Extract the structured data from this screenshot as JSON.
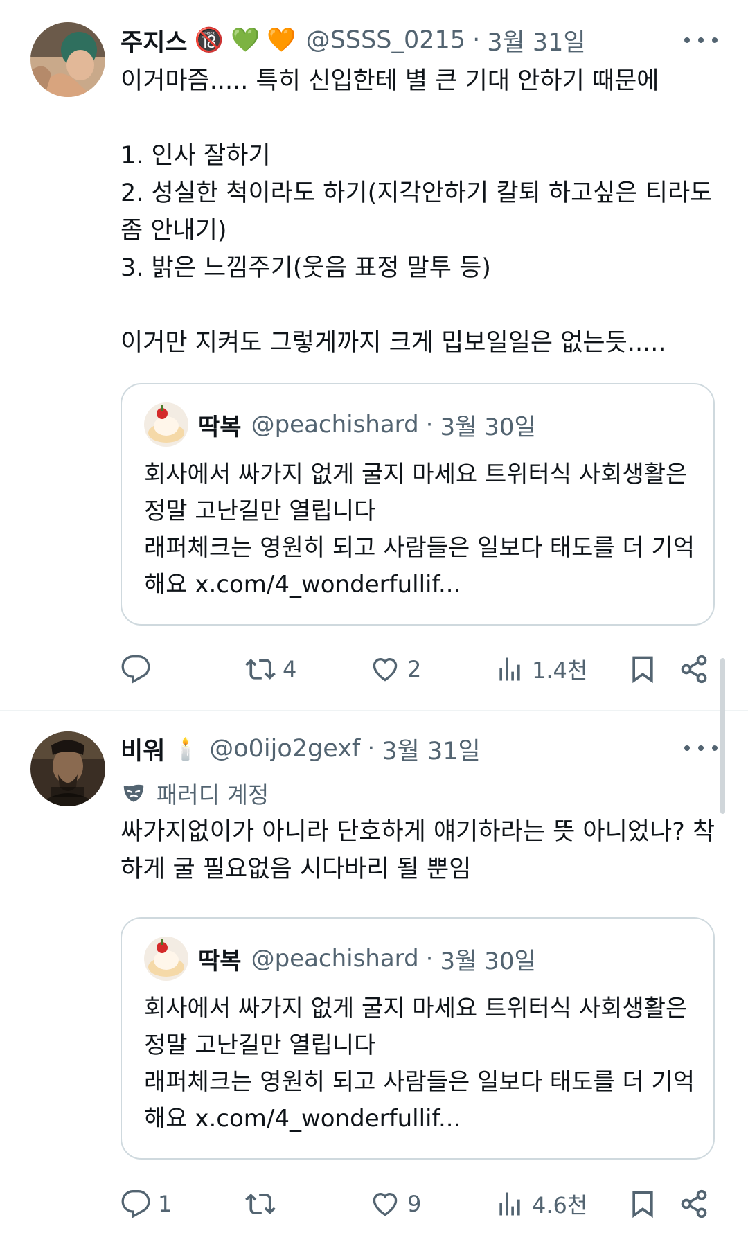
{
  "tweets": [
    {
      "name": "주지스",
      "emojis": [
        "🔞",
        "💚",
        "🧡"
      ],
      "handle": "@SSSS_0215",
      "date": "3월 31일",
      "text": "이거마즘..... 특히 신입한테 별 큰 기대 안하기 때문에\n\n1. 인사 잘하기\n2. 성실한 척이라도 하기(지각안하기 칼퇴 하고싶은 티라도 좀 안내기)\n3. 밝은 느낌주기(웃음 표정 말투 등)\n\n이거만 지켜도 그렇게까지 크게 밉보일일은 없는듯.....",
      "quote": {
        "name": "딱복",
        "handle": "@peachishard",
        "date": "3월 30일",
        "text": "회사에서 싸가지 없게 굴지 마세요 트위터식 사회생활은 정말 고난길만 열립니다\n래퍼체크는 영원히 되고 사람들은 일보다 태도를 더 기억해요 x.com/4_wonderfullif..."
      },
      "replies": "",
      "retweets": "4",
      "likes": "2",
      "views": "1.4천"
    },
    {
      "name": "비워",
      "emojis": [
        "🕯️"
      ],
      "handle": "@o0ijo2gexf",
      "date": "3월 31일",
      "label": "패러디 계정",
      "text": "싸가지없이가 아니라 단호하게 얘기하라는 뜻 아니었나? 착하게 굴 필요없음 시다바리 될 뿐임",
      "quote": {
        "name": "딱복",
        "handle": "@peachishard",
        "date": "3월 30일",
        "text": "회사에서 싸가지 없게 굴지 마세요 트위터식 사회생활은 정말 고난길만 열립니다\n래퍼체크는 영원히 되고 사람들은 일보다 태도를 더 기억해요 x.com/4_wonderfullif..."
      },
      "replies": "1",
      "retweets": "",
      "likes": "9",
      "views": "4.6천"
    }
  ],
  "icons": {
    "reply": "reply-icon",
    "retweet": "retweet-icon",
    "like": "heart-icon",
    "views": "views-icon",
    "bookmark": "bookmark-icon",
    "share": "share-icon",
    "more": "more-icon",
    "parody": "mask-icon"
  },
  "colors": {
    "secondary_text": "#536471",
    "border": "#cfd9de",
    "divider": "#eff3f4"
  }
}
